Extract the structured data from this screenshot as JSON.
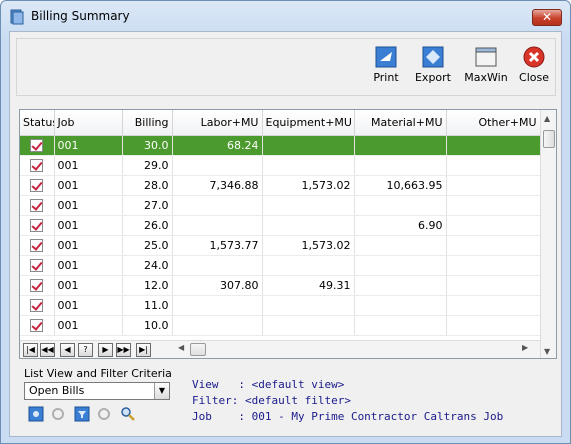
{
  "window": {
    "title": "Billing Summary",
    "close_glyph": "✕"
  },
  "toolbar": {
    "buttons": [
      {
        "label": "Print",
        "icon": "print-icon"
      },
      {
        "label": "Export",
        "icon": "export-icon"
      },
      {
        "label": "MaxWin",
        "icon": "maxwin-icon"
      },
      {
        "label": "Close",
        "icon": "close-icon"
      }
    ]
  },
  "grid": {
    "columns": [
      "Status",
      "Job",
      "Billing",
      "Labor+MU",
      "Equipment+MU",
      "Material+MU",
      "Other+MU"
    ],
    "rows": [
      {
        "job": "001",
        "billing": "30.0",
        "labor": "68.24",
        "equipment": "",
        "material": "",
        "other": "",
        "selected": true
      },
      {
        "job": "001",
        "billing": "29.0",
        "labor": "",
        "equipment": "",
        "material": "",
        "other": ""
      },
      {
        "job": "001",
        "billing": "28.0",
        "labor": "7,346.88",
        "equipment": "1,573.02",
        "material": "10,663.95",
        "other": ""
      },
      {
        "job": "001",
        "billing": "27.0",
        "labor": "",
        "equipment": "",
        "material": "",
        "other": ""
      },
      {
        "job": "001",
        "billing": "26.0",
        "labor": "",
        "equipment": "",
        "material": "6.90",
        "other": ""
      },
      {
        "job": "001",
        "billing": "25.0",
        "labor": "1,573.77",
        "equipment": "1,573.02",
        "material": "",
        "other": ""
      },
      {
        "job": "001",
        "billing": "24.0",
        "labor": "",
        "equipment": "",
        "material": "",
        "other": ""
      },
      {
        "job": "001",
        "billing": "12.0",
        "labor": "307.80",
        "equipment": "49.31",
        "material": "",
        "other": ""
      },
      {
        "job": "001",
        "billing": "11.0",
        "labor": "",
        "equipment": "",
        "material": "",
        "other": ""
      },
      {
        "job": "001",
        "billing": "10.0",
        "labor": "",
        "equipment": "",
        "material": "",
        "other": ""
      }
    ],
    "nav_buttons": [
      "|◀",
      "◀◀",
      "◀",
      "?",
      "▶",
      "▶▶",
      "▶|"
    ]
  },
  "criteria": {
    "label": "List View and Filter Criteria",
    "selected_view": "Open Bills"
  },
  "info": {
    "view_line": "View   : <default view>",
    "filter_line": "Filter: <default filter>",
    "job_line": "Job    : 001 - My Prime Contractor Caltrans Job"
  },
  "colors": {
    "selected_row": "#4a9a2d",
    "check_mark": "#c4243d",
    "info_text": "#1a1a8c"
  }
}
